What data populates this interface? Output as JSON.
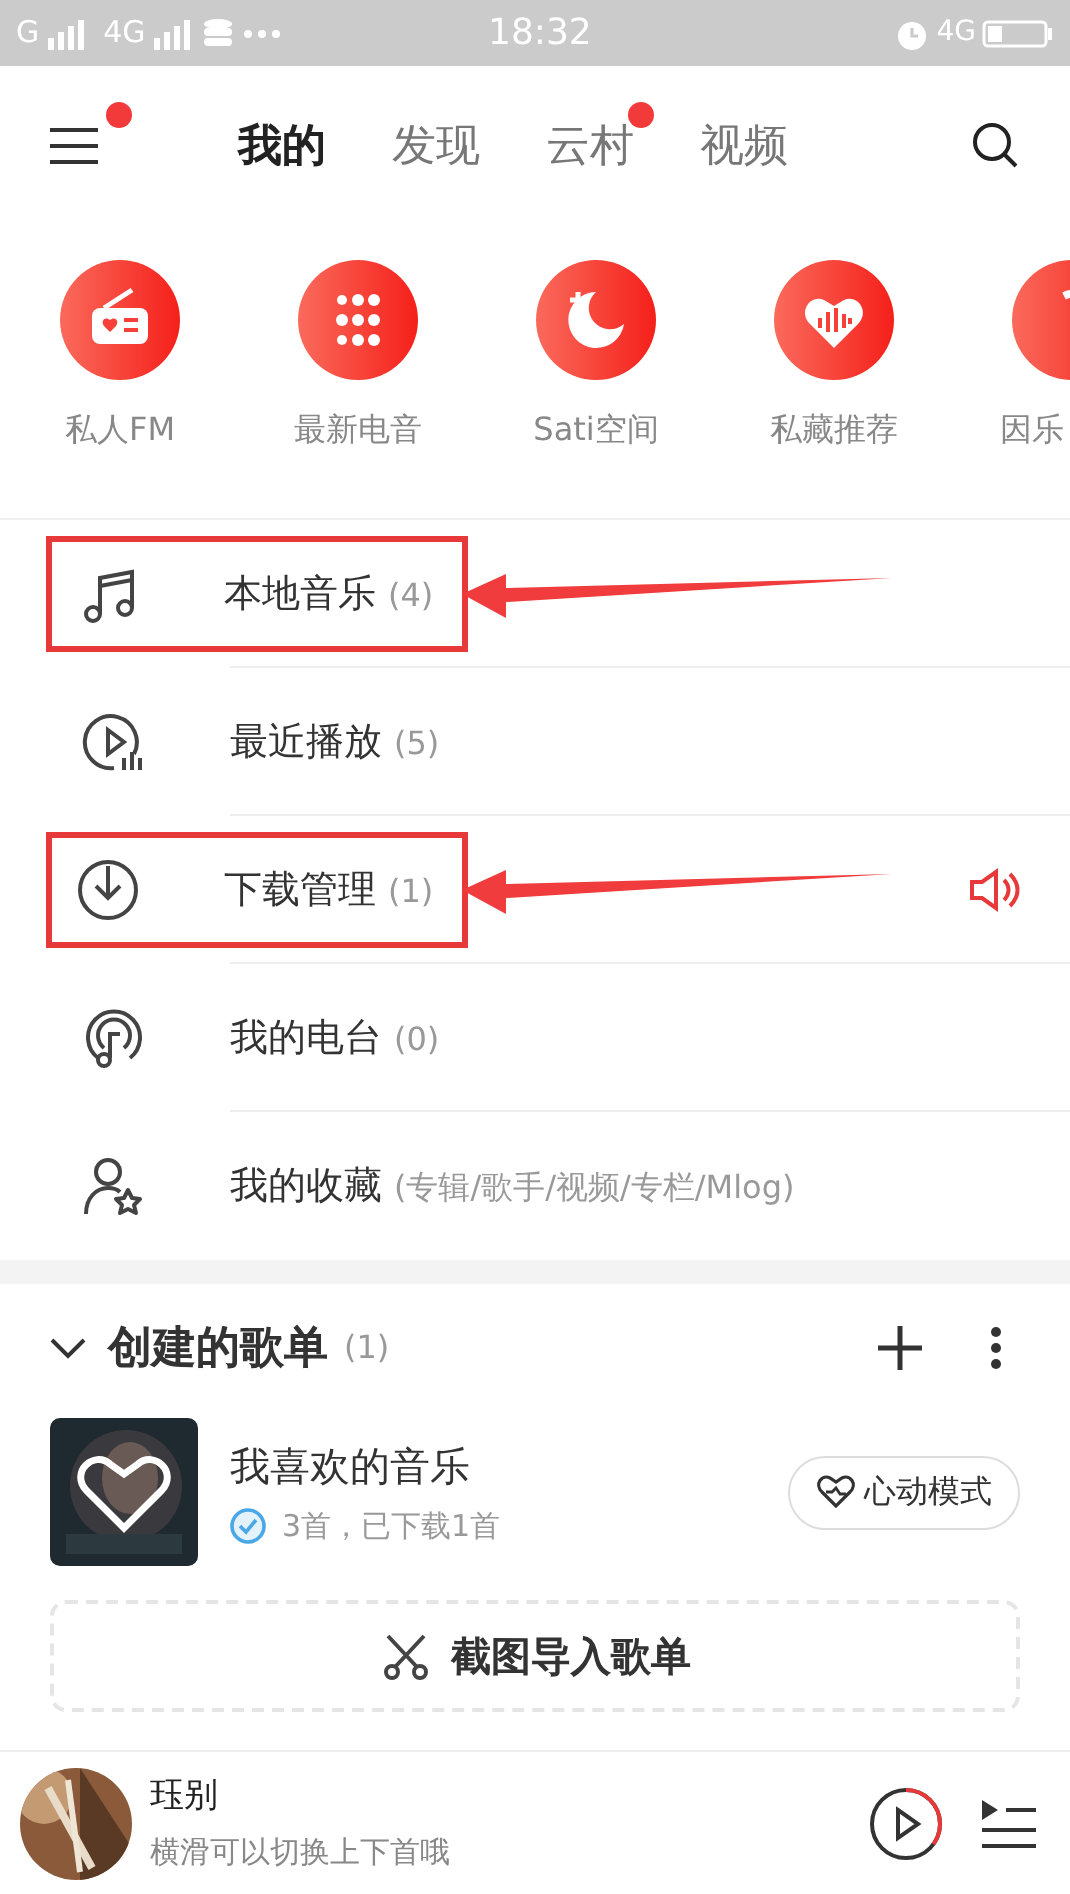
{
  "status_bar": {
    "carrier_1": "G",
    "carrier_2": "4G",
    "time": "18:32",
    "network": "4G"
  },
  "header": {
    "menu_badge": true,
    "tabs": [
      {
        "label": "我的",
        "selected": true,
        "badge": false
      },
      {
        "label": "发现",
        "selected": false,
        "badge": false
      },
      {
        "label": "云村",
        "selected": false,
        "badge": true
      },
      {
        "label": "视频",
        "selected": false,
        "badge": false
      }
    ]
  },
  "shortcuts": [
    {
      "kind": "radio",
      "label": "私人FM"
    },
    {
      "kind": "dots",
      "label": "最新电音"
    },
    {
      "kind": "moon",
      "label": "Sati空间"
    },
    {
      "kind": "heart",
      "label": "私藏推荐"
    },
    {
      "kind": "partial",
      "label": "因乐"
    }
  ],
  "menu": [
    {
      "kind": "music",
      "label": "本地音乐",
      "count": "(4)",
      "highlighted": true,
      "playing": false
    },
    {
      "kind": "recent",
      "label": "最近播放",
      "count": "(5)",
      "highlighted": false,
      "playing": false
    },
    {
      "kind": "download",
      "label": "下载管理",
      "count": "(1)",
      "highlighted": true,
      "playing": true
    },
    {
      "kind": "radio",
      "label": "我的电台",
      "count": "(0)",
      "highlighted": false,
      "playing": false
    },
    {
      "kind": "collect",
      "label": "我的收藏",
      "count": "(专辑/歌手/视频/专栏/Mlog)",
      "highlighted": false,
      "playing": false
    }
  ],
  "playlists": {
    "title": "创建的歌单",
    "count": "(1)",
    "expanded": true,
    "items": [
      {
        "name": "我喜欢的音乐",
        "detail": "3首，已下载1首",
        "downloaded": true,
        "action": "心动模式"
      }
    ],
    "import_label": "截图导入歌单"
  },
  "player": {
    "title": "珏别",
    "subtitle": "横滑可以切换上下首哦",
    "level": 0.35
  }
}
